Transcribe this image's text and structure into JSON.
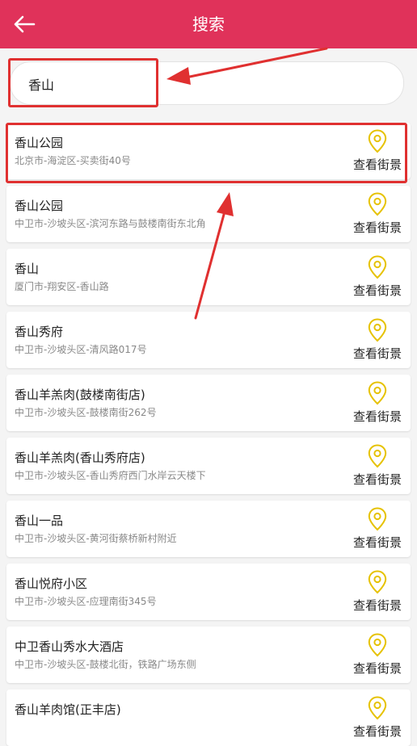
{
  "header": {
    "title": "搜索",
    "back_icon": "back-arrow-icon",
    "bg_color": "#e0325a"
  },
  "search": {
    "value": "香山"
  },
  "results": [
    {
      "name": "香山公园",
      "address": "北京市-海淀区-买卖街40号",
      "action": "查看街景"
    },
    {
      "name": "香山公园",
      "address": "中卫市-沙坡头区-滨河东路与鼓楼南街东北角",
      "action": "查看街景"
    },
    {
      "name": "香山",
      "address": "厦门市-翔安区-香山路",
      "action": "查看街景"
    },
    {
      "name": "香山秀府",
      "address": "中卫市-沙坡头区-清风路017号",
      "action": "查看街景"
    },
    {
      "name": "香山羊羔肉(鼓楼南街店)",
      "address": "中卫市-沙坡头区-鼓楼南街262号",
      "action": "查看街景"
    },
    {
      "name": "香山羊羔肉(香山秀府店)",
      "address": "中卫市-沙坡头区-香山秀府西门水岸云天楼下",
      "action": "查看街景"
    },
    {
      "name": "香山一品",
      "address": "中卫市-沙坡头区-黄河街蔡桥新村附近",
      "action": "查看街景"
    },
    {
      "name": "香山悦府小区",
      "address": "中卫市-沙坡头区-应理南街345号",
      "action": "查看街景"
    },
    {
      "name": "中卫香山秀水大酒店",
      "address": "中卫市-沙坡头区-鼓楼北街，铁路广场东侧",
      "action": "查看街景"
    },
    {
      "name": "香山羊肉馆(正丰店)",
      "address": "",
      "action": "查看街景"
    }
  ],
  "icons": {
    "pin_icon": "location-pin-icon",
    "pin_color": "#e6c200"
  },
  "annotation_color": "#e03030"
}
